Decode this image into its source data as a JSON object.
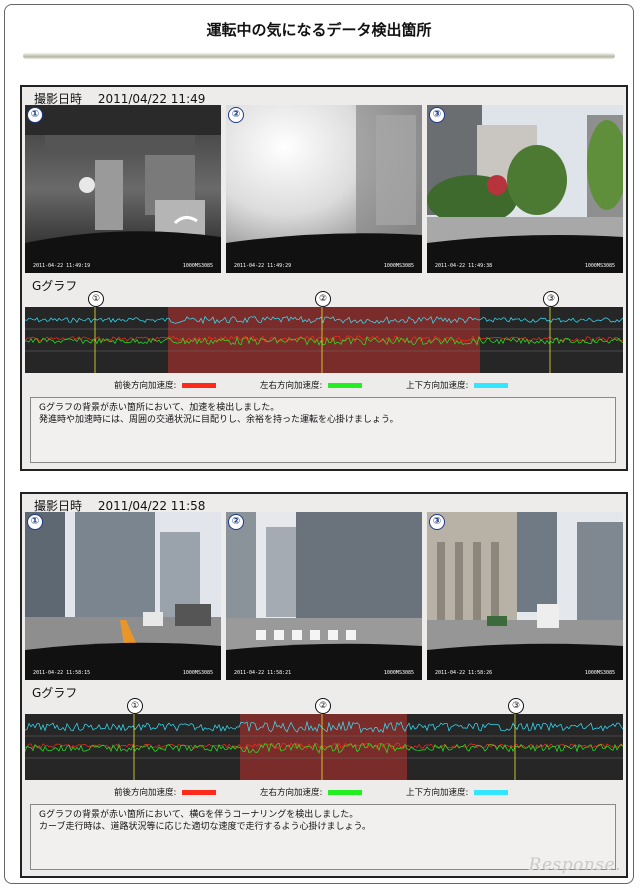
{
  "title": "運転中の気になるデータ検出箇所",
  "legend": {
    "front": "前後方向加速度:",
    "side": "左右方向加速度:",
    "vertical": "上下方向加速度:"
  },
  "colors": {
    "front": "#ff2a1a",
    "side": "#22ee22",
    "vertical": "#33e6ff",
    "highlight": "#7a2c2a",
    "graph_bg": "#262626"
  },
  "logo": "Response.",
  "reports": [
    {
      "header": "撮影日時　 2011/04/22 11:49",
      "photos": [
        {
          "num": "①",
          "stamp": "2011-04-22 11:49:19",
          "id": "1000MS3085"
        },
        {
          "num": "②",
          "stamp": "2011-04-22 11:49:29",
          "id": "1000MS3085"
        },
        {
          "num": "③",
          "stamp": "2011-04-22 11:49:38",
          "id": "1000MS3085"
        }
      ],
      "graph_title": "Gグラフ",
      "markers": [
        "①",
        "②",
        "③"
      ],
      "note_lines": [
        "Gグラフの背景が赤い箇所において、加速を検出しました。",
        "発進時や加速時には、周囲の交通状況に目配りし、余裕を持った運転を心掛けましょう。"
      ]
    },
    {
      "header": "撮影日時　 2011/04/22 11:58",
      "photos": [
        {
          "num": "①",
          "stamp": "2011-04-22 11:58:15",
          "id": "1000MS3085"
        },
        {
          "num": "②",
          "stamp": "2011-04-22 11:58:21",
          "id": "1000MS3085"
        },
        {
          "num": "③",
          "stamp": "2011-04-22 11:58:26",
          "id": "1000MS3085"
        }
      ],
      "graph_title": "Gグラフ",
      "markers": [
        "①",
        "②",
        "③"
      ],
      "note_lines": [
        "Gグラフの背景が赤い箇所において、横Gを伴うコーナリングを検出しました。",
        "カーブ走行時は、道路状況等に応じた適切な速度で走行するよう心掛けましょう。"
      ]
    }
  ]
}
